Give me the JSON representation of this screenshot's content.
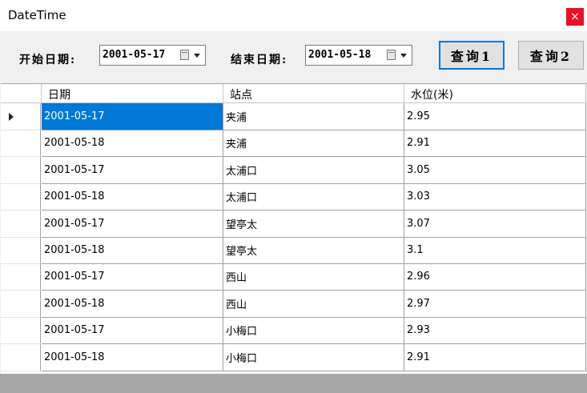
{
  "window": {
    "title": "DateTime",
    "close_glyph": "×"
  },
  "toolbar": {
    "start_label": "开始日期:",
    "start_value": "2001-05-17",
    "end_label": "结束日期:",
    "end_value": "2001-05-18",
    "query1_label": "查询1",
    "query2_label": "查询2"
  },
  "grid": {
    "columns": [
      "日期",
      "站点",
      "水位(米)"
    ],
    "rows": [
      {
        "date": "2001-05-17",
        "station": "夹浦",
        "level": "2.95"
      },
      {
        "date": "2001-05-18",
        "station": "夹浦",
        "level": "2.91"
      },
      {
        "date": "2001-05-17",
        "station": "太浦口",
        "level": "3.05"
      },
      {
        "date": "2001-05-18",
        "station": "太浦口",
        "level": "3.03"
      },
      {
        "date": "2001-05-17",
        "station": "望亭太",
        "level": "3.07"
      },
      {
        "date": "2001-05-18",
        "station": "望亭太",
        "level": "3.1"
      },
      {
        "date": "2001-05-17",
        "station": "西山",
        "level": "2.96"
      },
      {
        "date": "2001-05-18",
        "station": "西山",
        "level": "2.97"
      },
      {
        "date": "2001-05-17",
        "station": "小梅口",
        "level": "2.93"
      },
      {
        "date": "2001-05-18",
        "station": "小梅口",
        "level": "2.91"
      }
    ]
  },
  "colors": {
    "selection": "#0078d7",
    "close": "#e81123"
  }
}
